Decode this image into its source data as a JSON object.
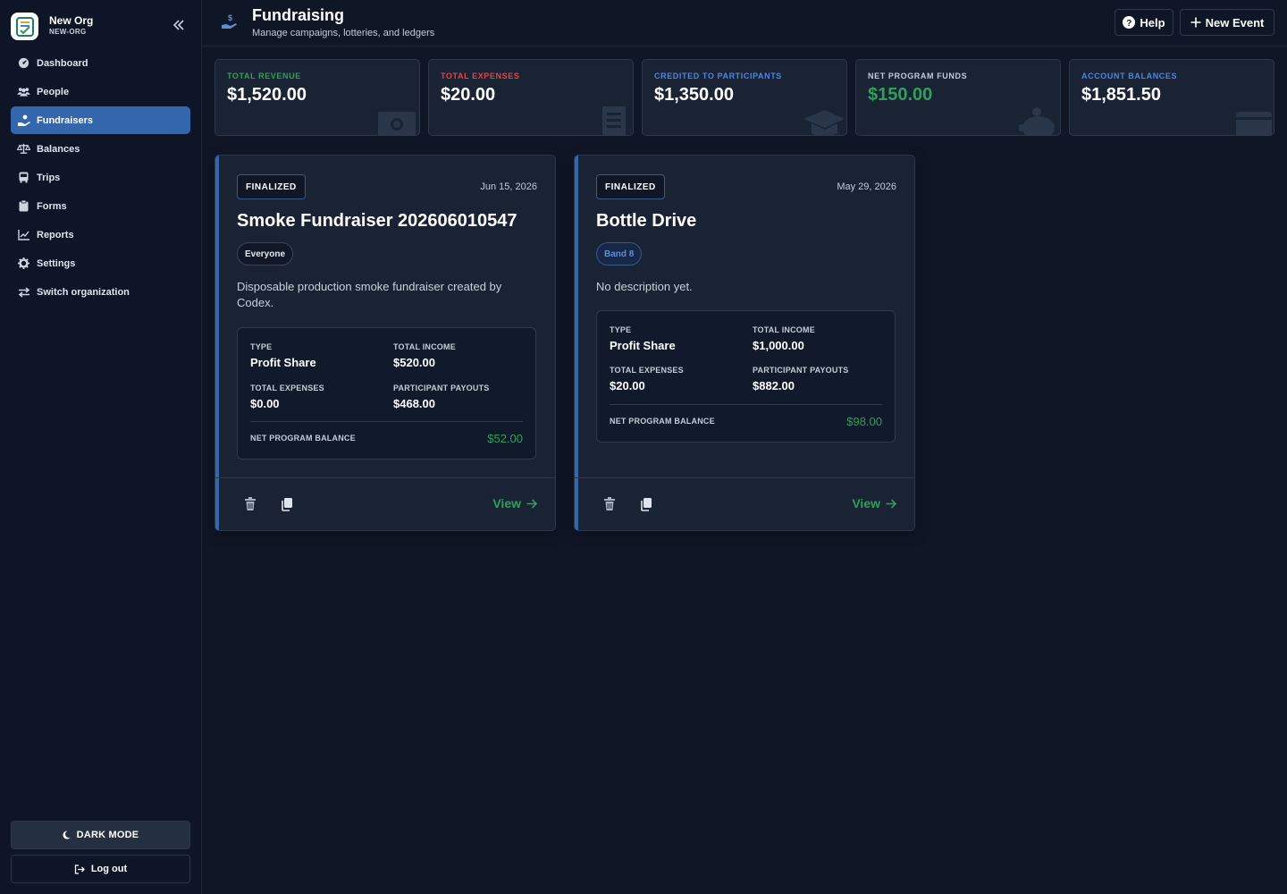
{
  "org": {
    "name": "New Org",
    "code": "NEW-ORG"
  },
  "nav": [
    {
      "label": "Dashboard",
      "icon": "dashboard-icon"
    },
    {
      "label": "People",
      "icon": "people-icon"
    },
    {
      "label": "Fundraisers",
      "icon": "fundraiser-icon",
      "active": true
    },
    {
      "label": "Balances",
      "icon": "scale-icon"
    },
    {
      "label": "Trips",
      "icon": "bus-icon"
    },
    {
      "label": "Forms",
      "icon": "clipboard-icon"
    },
    {
      "label": "Reports",
      "icon": "chart-icon"
    },
    {
      "label": "Settings",
      "icon": "gear-icon"
    },
    {
      "label": "Switch organization",
      "icon": "switch-icon"
    }
  ],
  "sidebar_footer": {
    "dark_mode": "DARK MODE",
    "logout": "Log out"
  },
  "header": {
    "title": "Fundraising",
    "subtitle": "Manage campaigns, lotteries, and ledgers",
    "help": "Help",
    "new_event": "New Event"
  },
  "stats": [
    {
      "label": "TOTAL REVENUE",
      "value": "$1,520.00",
      "label_color": "#2fa05a",
      "value_color": "#ffffff",
      "icon": "money-icon"
    },
    {
      "label": "TOTAL EXPENSES",
      "value": "$20.00",
      "label_color": "#e04646",
      "value_color": "#ffffff",
      "icon": "receipt-icon"
    },
    {
      "label": "CREDITED TO PARTICIPANTS",
      "value": "$1,350.00",
      "label_color": "#4f86e0",
      "value_color": "#ffffff",
      "icon": "graduation-cap-icon"
    },
    {
      "label": "NET PROGRAM FUNDS",
      "value": "$150.00",
      "label_color": "#c3cbd7",
      "value_color": "#2fa05a",
      "icon": "piggy-bank-icon"
    },
    {
      "label": "ACCOUNT BALANCES",
      "value": "$1,851.50",
      "label_color": "#4f86e0",
      "value_color": "#ffffff",
      "icon": "wallet-icon"
    }
  ],
  "events": [
    {
      "status": "FINALIZED",
      "date": "Jun 15, 2026",
      "title": "Smoke Fundraiser 202606010547",
      "group": "Everyone",
      "description": "Disposable production smoke fundraiser created by Codex.",
      "type_label": "TYPE",
      "type": "Profit Share",
      "income_label": "TOTAL INCOME",
      "income": "$520.00",
      "expenses_label": "TOTAL EXPENSES",
      "expenses": "$0.00",
      "payouts_label": "PARTICIPANT PAYOUTS",
      "payouts": "$468.00",
      "net_label": "NET PROGRAM BALANCE",
      "net": "$52.00",
      "view": "View"
    },
    {
      "status": "FINALIZED",
      "date": "May 29, 2026",
      "title": "Bottle Drive",
      "group": "Band 8",
      "description": "No description yet.",
      "type_label": "TYPE",
      "type": "Profit Share",
      "income_label": "TOTAL INCOME",
      "income": "$1,000.00",
      "expenses_label": "TOTAL EXPENSES",
      "expenses": "$20.00",
      "payouts_label": "PARTICIPANT PAYOUTS",
      "payouts": "$882.00",
      "net_label": "NET PROGRAM BALANCE",
      "net": "$98.00",
      "view": "View"
    }
  ]
}
